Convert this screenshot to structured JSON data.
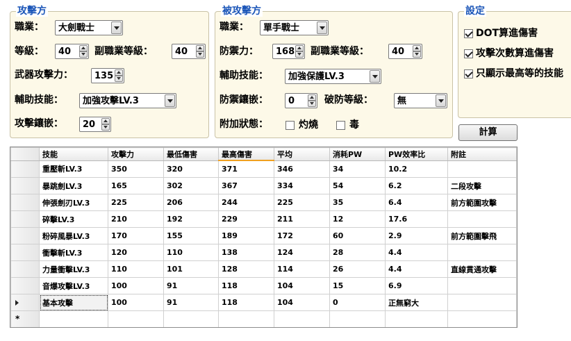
{
  "attacker": {
    "title": "攻擊方",
    "job_label": "職業：",
    "job_value": "大劍戰士",
    "level_label": "等級：",
    "level_value": "40",
    "sub_level_label": "副職業等級：",
    "sub_level_value": "40",
    "weapon_label": "武器攻擊力：",
    "weapon_value": "135",
    "skill_label": "輔助技能：",
    "skill_value": "加強攻擊LV.3",
    "inlay_label": "攻擊鑲嵌：",
    "inlay_value": "20"
  },
  "defender": {
    "title": "被攻擊方",
    "job_label": "職業：",
    "job_value": "單手戰士",
    "defense_label": "防禦力：",
    "defense_value": "168",
    "sub_level_label": "副職業等級：",
    "sub_level_value": "40",
    "skill_label": "輔助技能：",
    "skill_value": "加強保護LV.3",
    "inlay_label": "防禦鑲嵌：",
    "inlay_value": "0",
    "break_label": "破防等級：",
    "break_value": "無",
    "status_label": "附加狀態：",
    "burn_label": "灼燒",
    "poison_label": "毒"
  },
  "settings": {
    "title": "設定",
    "opt1": "DOT算進傷害",
    "opt2": "攻擊次數算進傷害",
    "opt3": "只顯示最高等的技能"
  },
  "calc_label": "計算",
  "table": {
    "headers": [
      "技能",
      "攻擊力",
      "最低傷害",
      "最高傷害",
      "平均",
      "消耗PW",
      "PW效率比",
      "附註"
    ],
    "rows": [
      [
        "重壓斬LV.3",
        "350",
        "320",
        "371",
        "346",
        "34",
        "10.2",
        ""
      ],
      [
        "暴跳劍LV.3",
        "165",
        "302",
        "367",
        "334",
        "54",
        "6.2",
        "二段攻擊"
      ],
      [
        "伸張劍刃LV.3",
        "225",
        "206",
        "244",
        "225",
        "35",
        "6.4",
        "前方範圍攻擊"
      ],
      [
        "碎擊LV.3",
        "210",
        "192",
        "229",
        "211",
        "12",
        "17.6",
        ""
      ],
      [
        "粉碎風暴LV.3",
        "170",
        "155",
        "189",
        "172",
        "60",
        "2.9",
        "前方範圍擊飛"
      ],
      [
        "衝擊斬LV.3",
        "120",
        "110",
        "138",
        "124",
        "28",
        "4.4",
        ""
      ],
      [
        "力量衝擊LV.3",
        "110",
        "101",
        "128",
        "114",
        "26",
        "4.4",
        "直線貫通攻擊"
      ],
      [
        "音爆攻擊LV.3",
        "100",
        "91",
        "118",
        "104",
        "15",
        "6.9",
        ""
      ],
      [
        "基本攻擊",
        "100",
        "91",
        "118",
        "104",
        "0",
        "正無窮大",
        ""
      ]
    ],
    "new_row_marker": "*"
  }
}
